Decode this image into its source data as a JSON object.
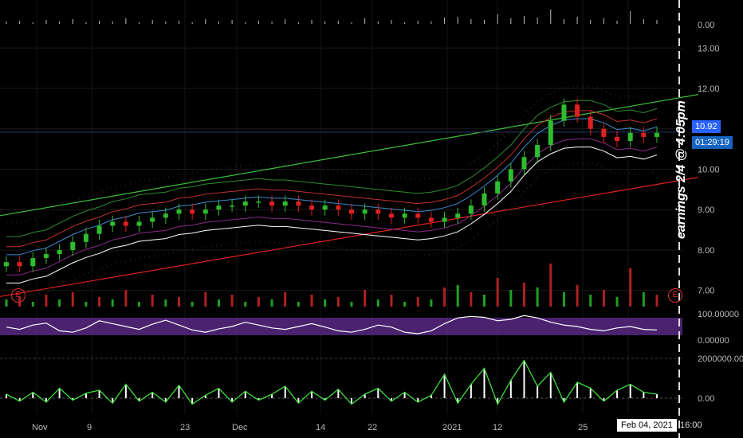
{
  "chart_data": [
    {
      "type": "candlestick",
      "panel": "price",
      "title": "",
      "y_axis_ticks": [
        "13.00",
        "12.00",
        "11.00",
        "10.00",
        "9.00",
        "8.00",
        "7.00"
      ],
      "ylim": [
        6.6,
        13.4
      ],
      "x_ticks": [
        "Nov",
        "9",
        "23",
        "Dec",
        "14",
        "22",
        "2021",
        "12",
        "25",
        "Feb 04, 2021",
        "16:00"
      ],
      "last_price": "10.92",
      "countdown": "01:29:19",
      "annotation": "earnings 2/4 @ 4:05pm",
      "earnings_marker": "E",
      "close_series": [
        7.7,
        7.6,
        7.8,
        7.9,
        8.0,
        8.2,
        8.4,
        8.6,
        8.7,
        8.6,
        8.7,
        8.8,
        8.9,
        9.0,
        8.9,
        9.0,
        9.1,
        9.1,
        9.2,
        9.2,
        9.1,
        9.2,
        9.1,
        9.0,
        9.1,
        9.0,
        8.9,
        9.0,
        8.9,
        8.8,
        8.9,
        8.8,
        8.7,
        8.8,
        8.9,
        9.1,
        9.4,
        9.7,
        10.0,
        10.3,
        10.6,
        11.2,
        11.6,
        11.3,
        11.0,
        10.8,
        10.7,
        10.9,
        10.8,
        10.9
      ],
      "colors": {
        "up": "#2ebd2e",
        "down": "#e02020",
        "upper_channel": "#3cbf3c",
        "lower_channel": "#e02020",
        "dots": "#d0d0d0",
        "price_badge": "#2196f3"
      }
    },
    {
      "type": "oscillator",
      "panel": "rsi",
      "y_axis_ticks": [
        "100.00000",
        "0.00000"
      ],
      "ylim": [
        0,
        100
      ],
      "values": [
        48,
        40,
        55,
        62,
        35,
        30,
        45,
        70,
        60,
        50,
        40,
        58,
        72,
        55,
        38,
        30,
        42,
        50,
        65,
        55,
        45,
        40,
        50,
        60,
        48,
        35,
        30,
        40,
        55,
        48,
        30,
        25,
        35,
        60,
        80,
        85,
        82,
        70,
        75,
        88,
        80,
        65,
        55,
        50,
        40,
        35,
        45,
        50,
        40,
        38
      ],
      "colors": {
        "band": "#5e2a8a",
        "line": "#ffffff"
      }
    },
    {
      "type": "histogram",
      "panel": "volume_oscillator",
      "y_axis_ticks": [
        "2000000.00",
        "0.00"
      ],
      "ylim": [
        -800000,
        2600000
      ],
      "values": [
        200000,
        -150000,
        300000,
        -200000,
        500000,
        -100000,
        250000,
        400000,
        -250000,
        700000,
        -150000,
        300000,
        -200000,
        650000,
        -300000,
        150000,
        500000,
        -200000,
        350000,
        -100000,
        200000,
        600000,
        -250000,
        350000,
        -100000,
        450000,
        -300000,
        200000,
        500000,
        -150000,
        300000,
        -200000,
        150000,
        1200000,
        -250000,
        700000,
        1500000,
        -300000,
        900000,
        1900000,
        600000,
        1300000,
        -200000,
        800000,
        500000,
        -150000,
        400000,
        700000,
        300000,
        200000
      ],
      "colors": {
        "bars": "#ffffff",
        "line": "#3cdd3c"
      }
    },
    {
      "type": "bar",
      "panel": "volume",
      "y_axis_ticks": [
        "0.00"
      ],
      "values": [
        3,
        4,
        2,
        5,
        3,
        6,
        2,
        4,
        3,
        7,
        2,
        5,
        3,
        4,
        2,
        6,
        3,
        5,
        2,
        4,
        3,
        6,
        2,
        5,
        3,
        4,
        2,
        7,
        3,
        5,
        2,
        4,
        3,
        8,
        9,
        6,
        5,
        12,
        7,
        10,
        8,
        18,
        6,
        9,
        5,
        7,
        4,
        16,
        6,
        5
      ]
    }
  ]
}
